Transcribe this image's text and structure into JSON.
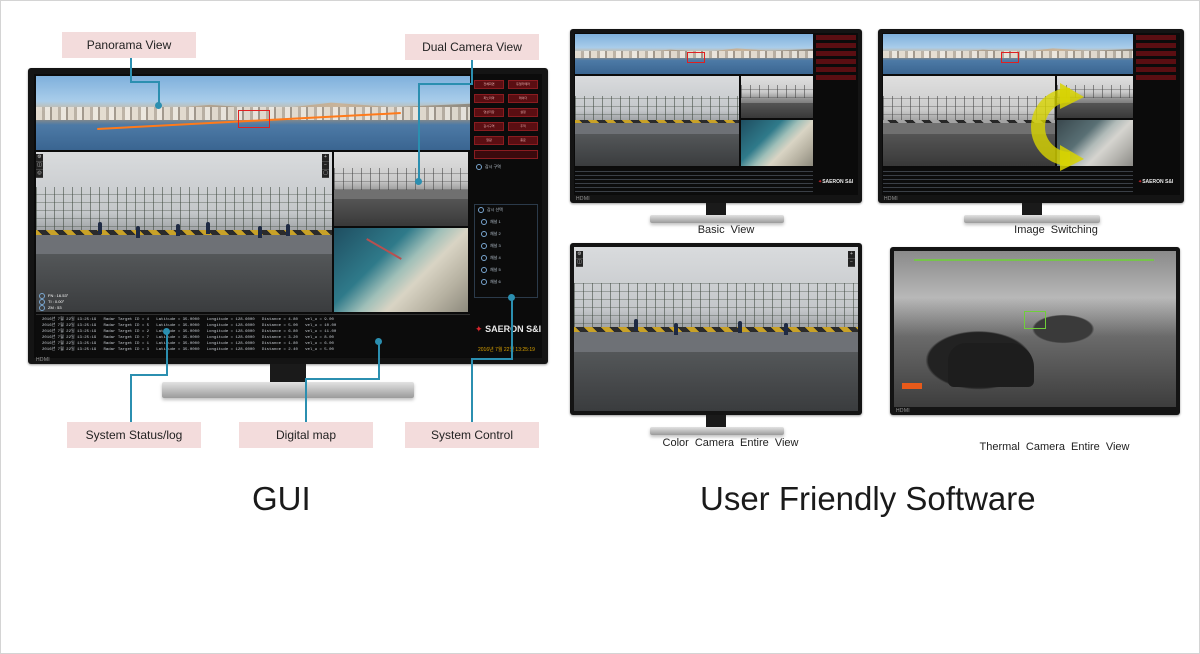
{
  "left": {
    "title": "GUI",
    "callouts": {
      "panorama": "Panorama View",
      "dual_camera": "Dual Camera View",
      "system_status": "System Status/log",
      "digital_map": "Digital map",
      "system_control": "System Control"
    },
    "monitor": {
      "brand": "HDMI",
      "logo": "SAERON S&I",
      "time": "2016년 7월 22일 13:25:19",
      "buttons": [
        "전체화면",
        "듀얼카메라",
        "파노라마",
        "레이더",
        "영상저장",
        "설정",
        "감시구역",
        "추적",
        "알람",
        "종료"
      ],
      "control_header": "감시 구역",
      "channel_label": "감시 선택",
      "channels": [
        "채널 1",
        "채널 2",
        "채널 3",
        "채널 4",
        "채널 5",
        "채널 6"
      ],
      "log_lines": [
        "2016년 7월 22일 13:25:19   Radar Target ID = 4   Latitude = 35.0000   Longitude = 128.6000   Distance = 4.80   vel_u = 9.00",
        "2016년 7월 22일 13:25:19   Radar Target ID = 5   Latitude = 35.0000   Longitude = 128.6000   Distance = 5.00   vel_u = 10.00",
        "2016년 7월 22일 13:25:19   Radar Target ID = 2   Latitude = 35.0000   Longitude = 128.6000   Distance = 6.80   vel_u = 11.00",
        "2016년 7월 22일 13:25:19   Radar Target ID = 7   Latitude = 35.0000   Longitude = 128.6000   Distance = 3.20   vel_u = 8.00",
        "2016년 7월 22일 13:25:19   Radar Target ID = 1   Latitude = 35.0000   Longitude = 128.6000   Distance = 1.80   vel_u = 6.00",
        "2016년 7월 22일 13:25:19   Radar Target ID = 3   Latitude = 35.0000   Longitude = 128.6000   Distance = 2.40   vel_u = 5.00"
      ],
      "overlay": [
        "FN : 16.53°",
        "TI : 0.00°",
        "ZM : 53"
      ]
    }
  },
  "right": {
    "title": "User Friendly Software",
    "captions": {
      "basic": "Basic View",
      "switching": "Image Switching",
      "color": "Color Camera Entire View",
      "thermal": "Thermal Camera Entire View"
    },
    "brand": "HDMI",
    "logo": "SAERON S&I"
  },
  "colors": {
    "callout_bg": "#f3dcdc",
    "connector": "#2b8fb0",
    "panel_button": "#5a0e12",
    "brand_red": "#d8262d"
  }
}
